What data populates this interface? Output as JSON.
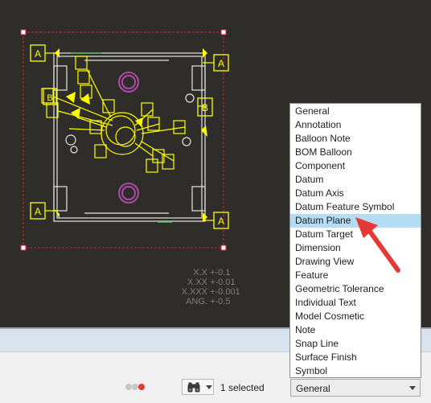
{
  "canvas": {
    "datum_labels": [
      "A",
      "A",
      "A",
      "A",
      "B",
      "B"
    ],
    "tolerances": [
      {
        "format": "X.X",
        "value": "+-0.1"
      },
      {
        "format": "X.XX",
        "value": "+-0.01"
      },
      {
        "format": "X.XXX",
        "value": "+-0.001"
      },
      {
        "format": "ANG.",
        "value": "+-0.5"
      }
    ]
  },
  "filter_dropdown": {
    "options": [
      "General",
      "Annotation",
      "Balloon Note",
      "BOM Balloon",
      "Component",
      "Datum",
      "Datum Axis",
      "Datum Feature Symbol",
      "Datum Plane",
      "Datum Target",
      "Dimension",
      "Drawing View",
      "Feature",
      "Geometric Tolerance",
      "Individual Text",
      "Model Cosmetic",
      "Note",
      "Snap Line",
      "Surface Finish",
      "Symbol"
    ],
    "highlighted": "Datum Plane"
  },
  "status_bar": {
    "selected_count": "1 selected",
    "filter_value": "General",
    "find_icon": "binoculars-icon"
  },
  "colors": {
    "accent_yellow": "#ffff00",
    "frame_red": "#d0243a",
    "highlight_blue": "#b4dcf3",
    "callout_red": "#e53935"
  }
}
